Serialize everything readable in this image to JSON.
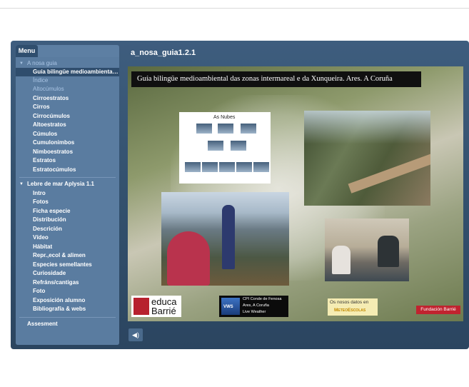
{
  "player": {
    "slide_title": "a_nosa_guia1.2.1",
    "audio_icon": "speaker-icon"
  },
  "menu": {
    "tab_label": "Menu",
    "section1": {
      "label": "A nosa guia",
      "items": [
        {
          "label": "Guía bilingüe medioambiental ..."
        },
        {
          "label": "Índice"
        },
        {
          "label": "Altocúmulos"
        },
        {
          "label": "Cirroestratos"
        },
        {
          "label": "Cirros"
        },
        {
          "label": "Cirrocúmulos"
        },
        {
          "label": "Altoestratos"
        },
        {
          "label": "Cúmulos"
        },
        {
          "label": "Cumulonimbos"
        },
        {
          "label": "Nimboestratos"
        },
        {
          "label": "Estratos"
        },
        {
          "label": "Estratocúmulos"
        }
      ]
    },
    "section2": {
      "label": "Lebre de mar Aplysia 1.1",
      "items": [
        {
          "label": "Intro"
        },
        {
          "label": "Fotos"
        },
        {
          "label": "Ficha especie"
        },
        {
          "label": "Distribución"
        },
        {
          "label": "Descrición"
        },
        {
          "label": "Vídeo"
        },
        {
          "label": "Hábitat"
        },
        {
          "label": "Repr.,ecol & alimen"
        },
        {
          "label": "Especies semellantes"
        },
        {
          "label": "Curiosidade"
        },
        {
          "label": "Refráns/cantigas"
        },
        {
          "label": "Foto"
        },
        {
          "label": "Exposición alumno"
        },
        {
          "label": "Bibliografía & webs"
        }
      ]
    },
    "assessment_label": "Assesment"
  },
  "slide": {
    "banner": "Guía bilingüe medioambiental das zonas intermareal e da Xunqueira. Ares. A Coruña",
    "clouds_title": "As Nubes",
    "logo_educa_line1": "educa",
    "logo_educa_line2": "Barrié",
    "vws_line1": "CPI Conde de Fenosa",
    "vws_line2": "Ares, A Coruña",
    "vws_line3": "Live Weather",
    "vws_mark": "VWS",
    "meteo_line1": "Os nosos datos en",
    "meteo_line2": "MeteoEscolas",
    "fundacion": "Fundación Barrié"
  }
}
